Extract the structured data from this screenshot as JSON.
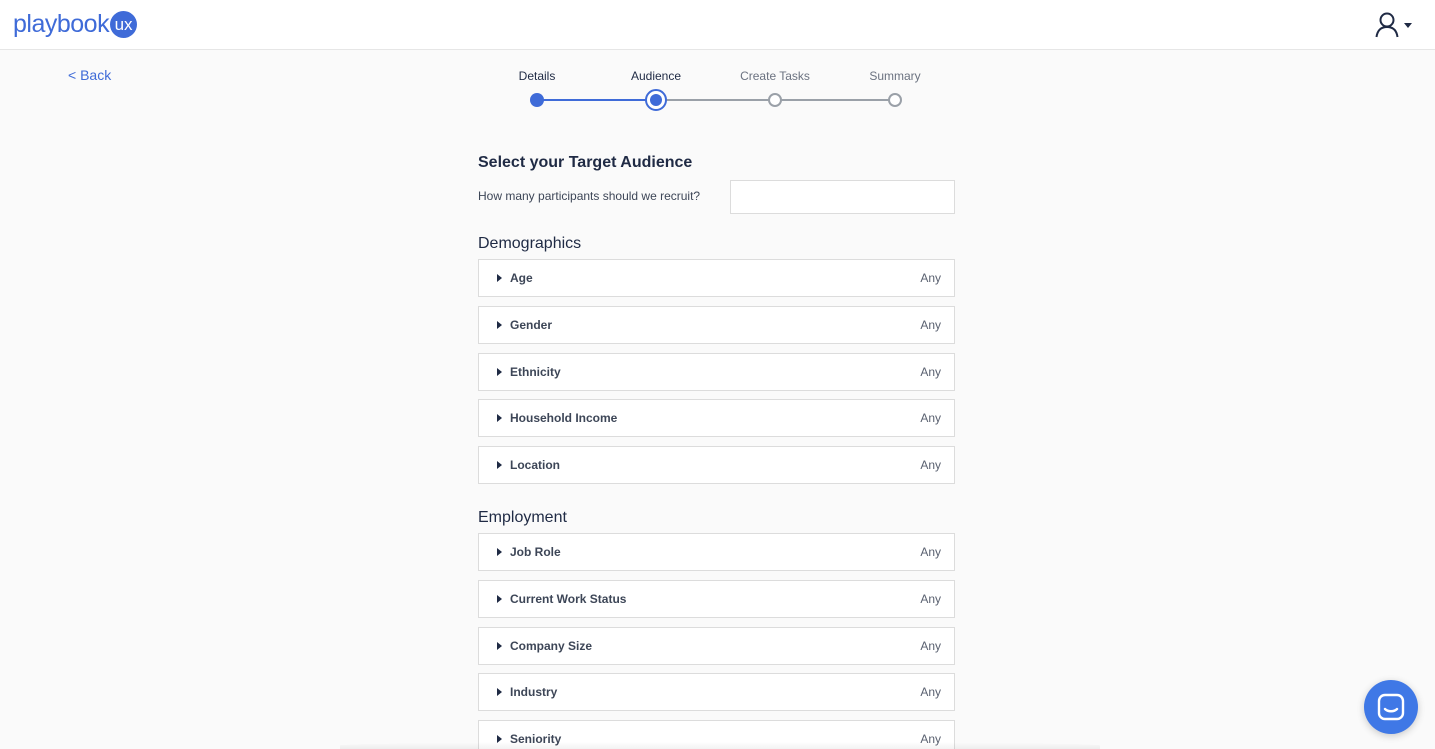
{
  "header": {
    "logo_text": "playbook",
    "logo_badge": "ux"
  },
  "nav": {
    "back_label": "< Back"
  },
  "stepper": {
    "steps": [
      {
        "label": "Details",
        "state": "completed"
      },
      {
        "label": "Audience",
        "state": "current"
      },
      {
        "label": "Create Tasks",
        "state": "upcoming"
      },
      {
        "label": "Summary",
        "state": "upcoming"
      }
    ]
  },
  "audience": {
    "title": "Select your Target Audience",
    "recruit_label": "How many participants should we recruit?",
    "recruit_value": ""
  },
  "demographics": {
    "title": "Demographics",
    "filters": [
      {
        "label": "Age",
        "value": "Any"
      },
      {
        "label": "Gender",
        "value": "Any"
      },
      {
        "label": "Ethnicity",
        "value": "Any"
      },
      {
        "label": "Household Income",
        "value": "Any"
      },
      {
        "label": "Location",
        "value": "Any"
      }
    ]
  },
  "employment": {
    "title": "Employment",
    "filters": [
      {
        "label": "Job Role",
        "value": "Any"
      },
      {
        "label": "Current Work Status",
        "value": "Any"
      },
      {
        "label": "Company Size",
        "value": "Any"
      },
      {
        "label": "Industry",
        "value": "Any"
      },
      {
        "label": "Seniority",
        "value": "Any"
      }
    ]
  },
  "icons": {
    "user": "user-icon",
    "caret": "caret-right-icon",
    "chat": "chat-icon"
  },
  "colors": {
    "accent": "#3f6bd8",
    "chat": "#3f78e6",
    "upcoming": "#9aa0a8"
  }
}
